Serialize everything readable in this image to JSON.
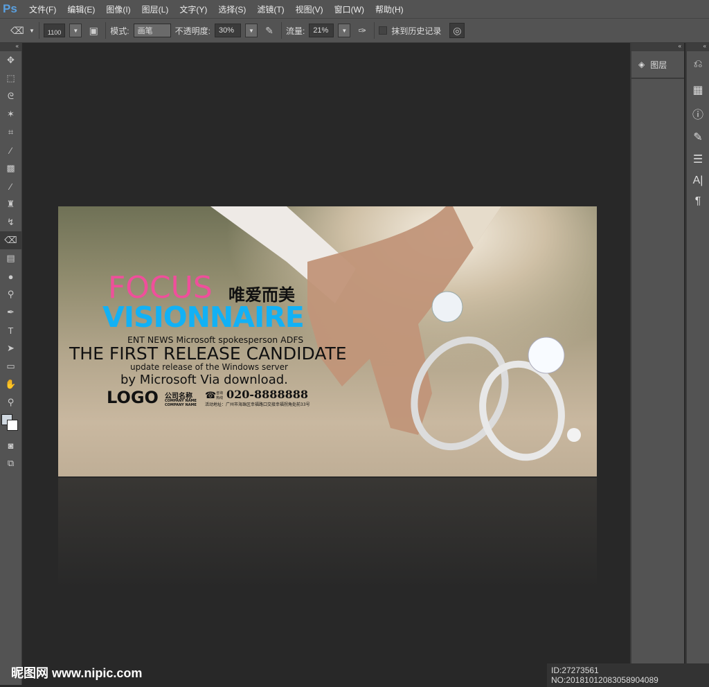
{
  "app": {
    "logo": "Ps"
  },
  "menu": [
    "文件(F)",
    "编辑(E)",
    "图像(I)",
    "图层(L)",
    "文字(Y)",
    "选择(S)",
    "滤镜(T)",
    "视图(V)",
    "窗口(W)",
    "帮助(H)"
  ],
  "options": {
    "brush_size": "1100",
    "mode_label": "模式:",
    "mode_value": "画笔",
    "opacity_label": "不透明度:",
    "opacity_value": "30%",
    "flow_label": "流量:",
    "flow_value": "21%",
    "erase_history_label": "抹到历史记录"
  },
  "panel": {
    "layers_label": "图层"
  },
  "banner": {
    "focus": "FOCUS",
    "chinese_title": "唯爱而美",
    "visionnaire": "VISIONNAIRE",
    "line1": "ENT NEWS Microsoft spokesperson ADFS",
    "line2": "THE FIRST RELEASE CANDIDATE",
    "line3": "update release of the Windows server",
    "line4": "by Microsoft Via download.",
    "logo": "LOGO",
    "company_cn": "公司名称",
    "company_en1": "COMPANY NAME",
    "company_en2": "COMPANY NAME",
    "hotline_label": "咨询热线",
    "phone": "020-8888888",
    "address": "活动地址：广州市海珠区幸福路口交接幸福拐角处前33号",
    "colors": {
      "pink": "#ef4f9b",
      "blue": "#12b1f5"
    }
  },
  "watermark": {
    "site": "昵图网 www.nipic.com",
    "id": "ID:27273561 NO:20181012083058904089"
  }
}
